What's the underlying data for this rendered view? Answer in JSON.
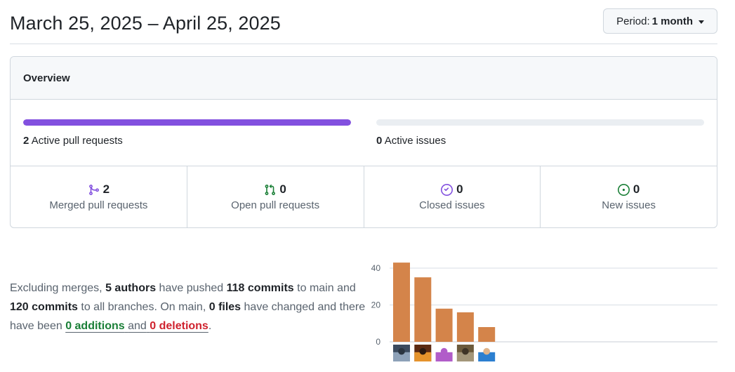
{
  "header": {
    "date_range": "March 25, 2025 – April 25, 2025",
    "period_label": "Period:",
    "period_value": "1 month"
  },
  "overview": {
    "title": "Overview",
    "pull_requests": {
      "count": "2",
      "label": "Active pull requests",
      "fraction": 1.0,
      "color": "#8250df"
    },
    "issues": {
      "count": "0",
      "label": "Active issues",
      "fraction": 0.0,
      "color": "#1a7f37"
    },
    "stats": [
      {
        "icon": "merged-pr-icon",
        "value": "2",
        "label": "Merged pull requests",
        "color": "#8250df"
      },
      {
        "icon": "open-pr-icon",
        "value": "0",
        "label": "Open pull requests",
        "color": "#1a7f37"
      },
      {
        "icon": "closed-issue-icon",
        "value": "0",
        "label": "Closed issues",
        "color": "#8250df"
      },
      {
        "icon": "new-issue-icon",
        "value": "0",
        "label": "New issues",
        "color": "#1a7f37"
      }
    ]
  },
  "summary": {
    "p1": "Excluding merges,",
    "authors": "5 authors",
    "p2": "have pushed",
    "commits_main": "118 commits",
    "p3": "to main and",
    "commits_all": "120 commits",
    "p4": "to all branches. On main,",
    "files": "0 files",
    "p5": "have changed and there have been",
    "additions": "0 additions",
    "p6": "and",
    "deletions": "0 deletions",
    "p7": "."
  },
  "chart_data": {
    "type": "bar",
    "categories": [
      "author-1",
      "author-2",
      "author-3",
      "author-4",
      "author-5"
    ],
    "values": [
      43,
      35,
      18,
      16,
      8
    ],
    "ylim": [
      0,
      40
    ],
    "yticks": [
      "0",
      "20",
      "40"
    ],
    "grid": true,
    "bar_color": "#d4844a",
    "avatars": [
      "avatar-landscape",
      "avatar-sunset",
      "avatar-castle",
      "avatar-photo",
      "avatar-person"
    ]
  }
}
